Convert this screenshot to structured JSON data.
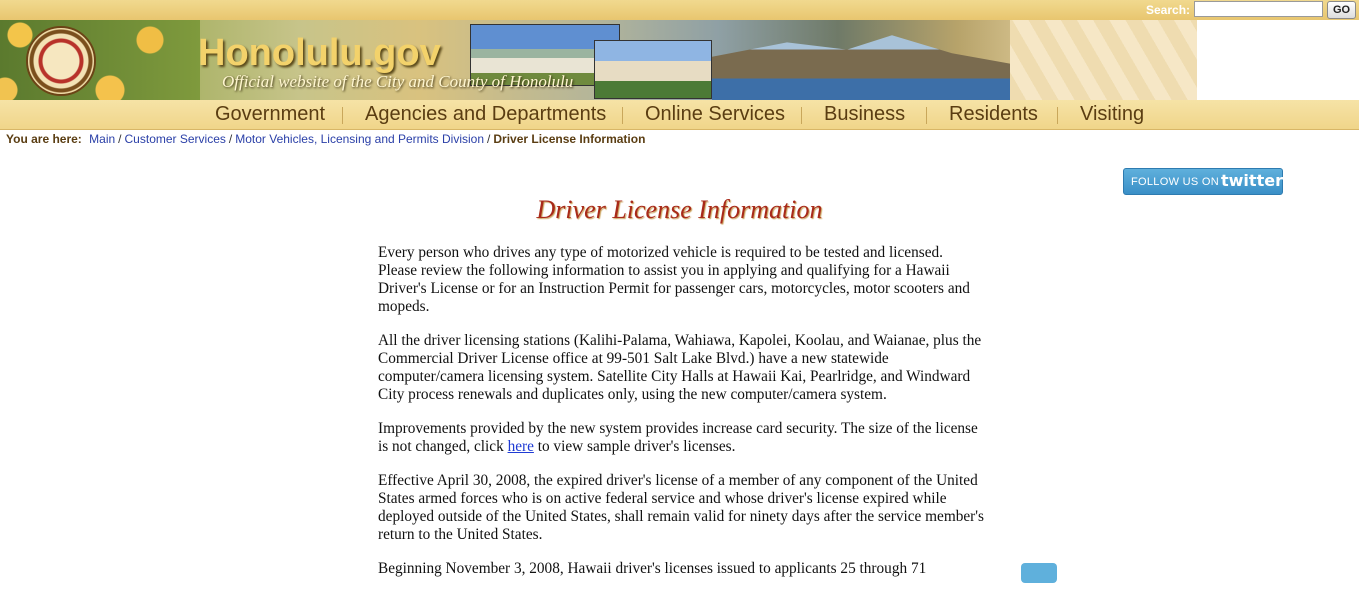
{
  "search": {
    "label": "Search:",
    "value": "",
    "button": "GO"
  },
  "header": {
    "title": "Honolulu.gov",
    "subtitle": "Official website of the City and County of Honolulu"
  },
  "nav": [
    "Government",
    "Agencies and Departments",
    "Online Services",
    "Business",
    "Residents",
    "Visiting"
  ],
  "breadcrumb": {
    "label": "You are here:",
    "links": [
      "Main",
      "Customer Services",
      "Motor Vehicles, Licensing and Permits Division"
    ],
    "current": "Driver License Information"
  },
  "twitter": {
    "follow": "FOLLOW US ON",
    "brand": "twitter"
  },
  "page": {
    "title": "Driver License Information",
    "p1": "Every person who drives any type of motorized vehicle is required to be tested and licensed. Please review the following information to assist you in applying and qualifying for a Hawaii Driver's License or for an Instruction Permit for passenger cars, motorcycles, motor scooters and mopeds.",
    "p2": "All the driver licensing stations (Kalihi-Palama, Wahiawa, Kapolei, Koolau, and Waianae, plus the Commercial Driver License office at 99-501 Salt Lake Blvd.) have a new statewide computer/camera licensing system. Satellite City Halls at Hawaii Kai, Pearlridge, and Windward City process renewals and duplicates only, using the new computer/camera system.",
    "p3_before": "Improvements provided by the new system provides increase card security.  The size of the license is not changed, click ",
    "p3_link": "here",
    "p3_after": " to view sample driver's licenses.",
    "p4": "Effective April 30, 2008, the expired driver's license of a member of any component of the United States armed forces who is on active federal service and whose driver's license expired while deployed outside of the United States, shall remain valid for ninety days after the service member's return to the United States.",
    "p5": "Beginning November 3, 2008, Hawaii driver's licenses issued to applicants 25 through 71"
  }
}
